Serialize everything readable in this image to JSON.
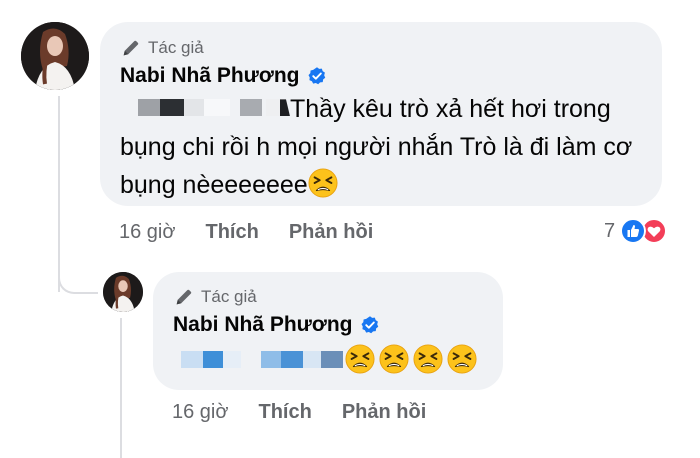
{
  "colors": {
    "bubble": "#f0f2f5",
    "secondary_text": "#65676b",
    "verified_blue": "#1877f2",
    "like_blue": "#1877f2",
    "love_red": "#f33e58"
  },
  "comment": {
    "badge": "Tác giả",
    "badge_icon": "pen-icon",
    "author": "Nabi Nhã Phương",
    "verified_icon": "verified-badge-icon",
    "text": "Thầy kêu trò xả hết hơi trong bụng chi rồi h mọi người nhắn Trò là đi làm cơ bụng nèeeeeeee",
    "emoji": "tired-face-emoji",
    "time": "16 giờ",
    "like": "Thích",
    "reply": "Phản hồi",
    "reaction_count": "7",
    "reaction_icons": [
      "like-icon",
      "love-icon"
    ]
  },
  "reply": {
    "badge": "Tác giả",
    "badge_icon": "pen-icon",
    "author": "Nabi Nhã Phương",
    "verified_icon": "verified-badge-icon",
    "emojis": [
      "tired-face-emoji",
      "tired-face-emoji",
      "tired-face-emoji",
      "tired-face-emoji"
    ],
    "time": "16 giờ",
    "like": "Thích",
    "reply": "Phản hồi"
  }
}
